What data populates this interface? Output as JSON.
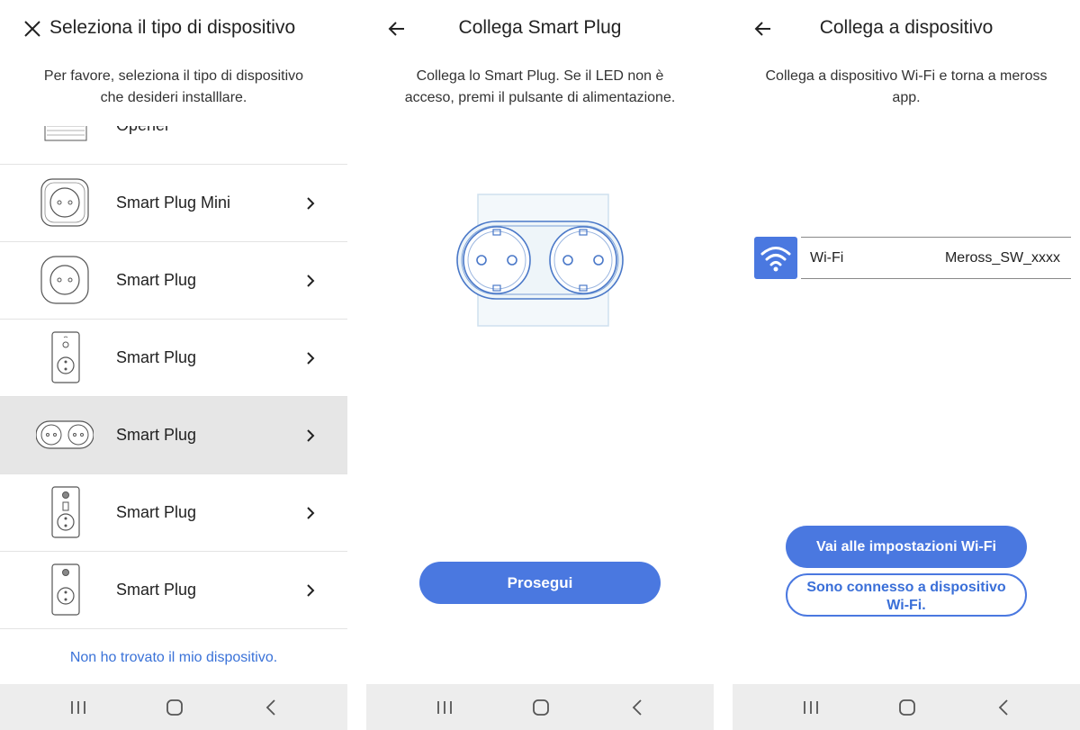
{
  "select_screen": {
    "title": "Seleziona il tipo di dispositivo",
    "subtitle_line1": "Per favore, seleziona il tipo di dispositivo",
    "subtitle_line2": "che desideri installlare.",
    "partial_item_label": "Opener",
    "items": [
      {
        "label": "Smart Plug Mini",
        "icon": "square-plug-icon",
        "selected": false
      },
      {
        "label": "Smart Plug",
        "icon": "round-plug-icon",
        "selected": false
      },
      {
        "label": "Smart Plug",
        "icon": "vertical-plug-icon",
        "selected": false
      },
      {
        "label": "Smart Plug",
        "icon": "double-plug-icon",
        "selected": true
      },
      {
        "label": "Smart Plug",
        "icon": "vertical-plug-usb-icon",
        "selected": false
      },
      {
        "label": "Smart Plug",
        "icon": "vertical-plug-icon",
        "selected": false
      }
    ],
    "not_found_link": "Non ho trovato il mio dispositivo."
  },
  "connect_plug_screen": {
    "title": "Collega Smart Plug",
    "subtitle_line1": "Collega lo Smart Plug. Se il LED non è",
    "subtitle_line2": "acceso, premi il pulsante di alimentazione.",
    "continue_button": "Prosegui"
  },
  "connect_device_screen": {
    "title": "Collega a dispositivo",
    "subtitle_line1": "Collega a dispositivo Wi-Fi e torna a meross",
    "subtitle_line2": "app.",
    "wifi_label": "Wi-Fi",
    "wifi_network": "Meross_SW_xxxx",
    "settings_button": "Vai alle impostazioni Wi-Fi",
    "connected_button_line1": "Sono connesso a dispositivo",
    "connected_button_line2": "Wi-Fi."
  },
  "colors": {
    "accent": "#4a78e0",
    "link": "#3a72d8",
    "selected_row": "#e6e6e6",
    "navbar": "#ededed"
  }
}
